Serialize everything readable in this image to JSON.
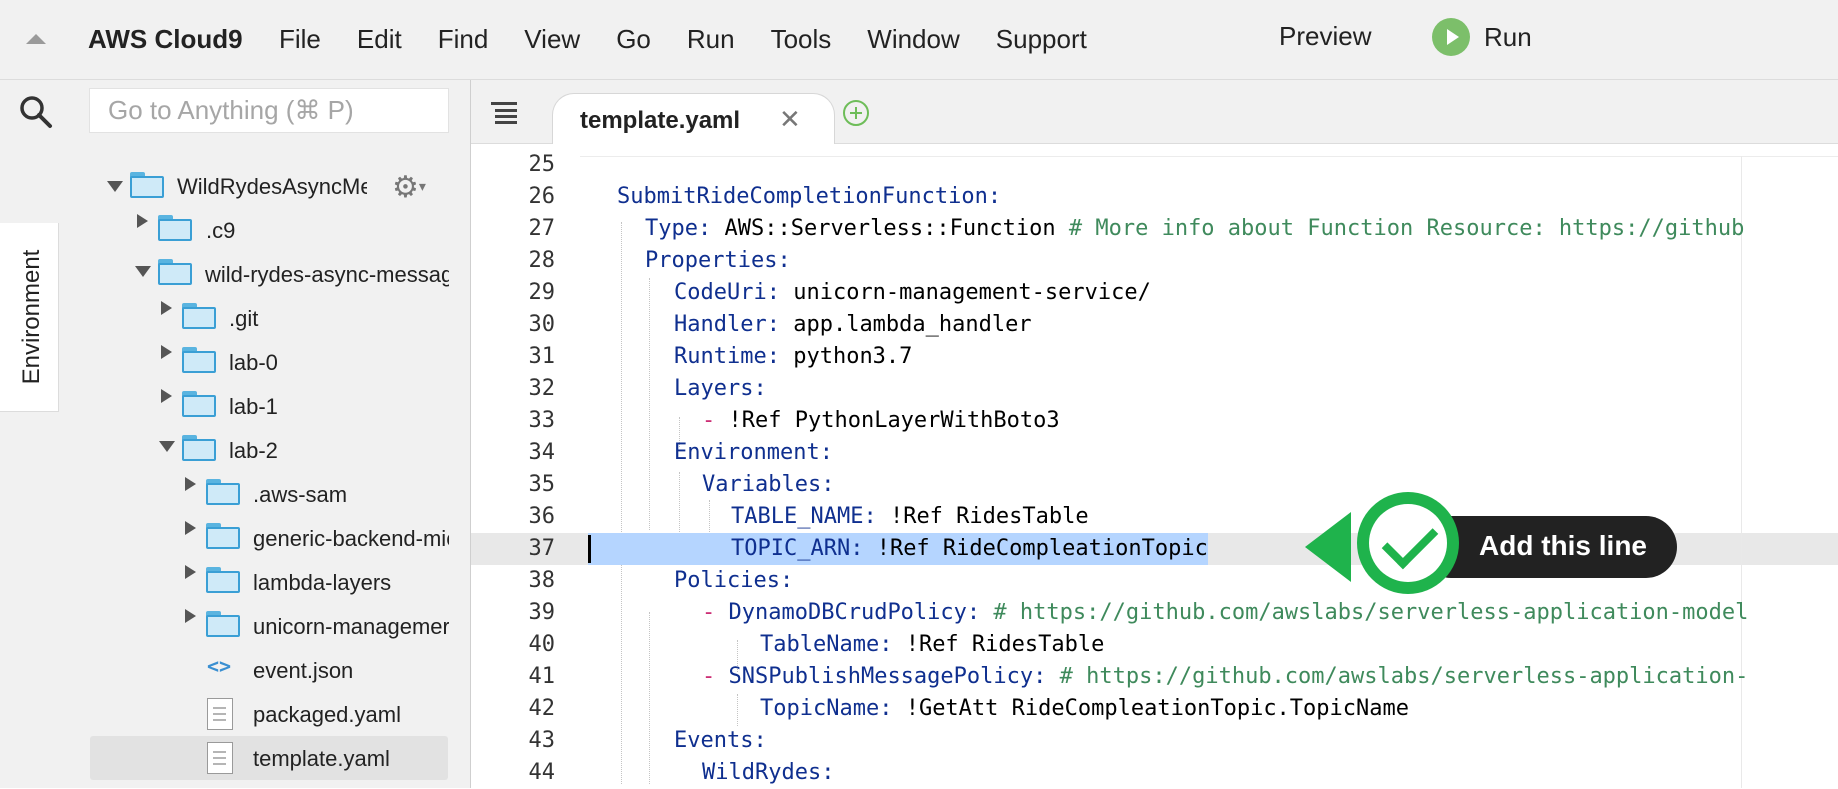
{
  "app": {
    "brand": "AWS Cloud9",
    "menu": [
      "File",
      "Edit",
      "Find",
      "View",
      "Go",
      "Run",
      "Tools",
      "Window",
      "Support"
    ],
    "preview_label": "Preview",
    "run_label": "Run"
  },
  "sidebar": {
    "environment_tab": "Environment",
    "search_placeholder": "Go to Anything (⌘ P)"
  },
  "tree": [
    {
      "label": "WildRydesAsyncMes",
      "type": "folder",
      "expanded": true
    },
    {
      "label": ".c9",
      "type": "folder",
      "expanded": false
    },
    {
      "label": "wild-rydes-async-messag",
      "type": "folder",
      "expanded": true
    },
    {
      "label": ".git",
      "type": "folder",
      "expanded": false
    },
    {
      "label": "lab-0",
      "type": "folder",
      "expanded": false
    },
    {
      "label": "lab-1",
      "type": "folder",
      "expanded": false
    },
    {
      "label": "lab-2",
      "type": "folder",
      "expanded": true
    },
    {
      "label": ".aws-sam",
      "type": "folder",
      "expanded": false
    },
    {
      "label": "generic-backend-mic",
      "type": "folder",
      "expanded": false
    },
    {
      "label": "lambda-layers",
      "type": "folder",
      "expanded": false
    },
    {
      "label": "unicorn-managemer",
      "type": "folder",
      "expanded": false
    },
    {
      "label": "event.json",
      "type": "json-file"
    },
    {
      "label": "packaged.yaml",
      "type": "file"
    },
    {
      "label": "template.yaml",
      "type": "file",
      "selected": true
    }
  ],
  "editor": {
    "tab_label": "template.yaml",
    "lines": [
      {
        "num": "25"
      },
      {
        "num": "26"
      },
      {
        "num": "27"
      },
      {
        "num": "28"
      },
      {
        "num": "29"
      },
      {
        "num": "30"
      },
      {
        "num": "31"
      },
      {
        "num": "32"
      },
      {
        "num": "33"
      },
      {
        "num": "34"
      },
      {
        "num": "35"
      },
      {
        "num": "36"
      },
      {
        "num": "37"
      },
      {
        "num": "38"
      },
      {
        "num": "39"
      },
      {
        "num": "40"
      },
      {
        "num": "41"
      },
      {
        "num": "42"
      },
      {
        "num": "43"
      },
      {
        "num": "44"
      }
    ],
    "code": {
      "l26_key": "SubmitRideCompletionFunction:",
      "l27_key": "Type:",
      "l27_val": " AWS::Serverless::Function ",
      "l27_comment": "# More info about Function Resource: https://github",
      "l28_key": "Properties:",
      "l29_key": "CodeUri:",
      "l29_val": " unicorn-management-service/",
      "l30_key": "Handler:",
      "l30_val": " app.lambda_handler",
      "l31_key": "Runtime:",
      "l31_val": " python3.7",
      "l32_key": "Layers:",
      "l33_dash": "- ",
      "l33_val": "!Ref PythonLayerWithBoto3",
      "l34_key": "Environment:",
      "l35_key": "Variables:",
      "l36_key": "TABLE_NAME:",
      "l36_val": " !Ref RidesTable",
      "l37_key": "TOPIC_ARN:",
      "l37_val": " !Ref RideCompleationTopic",
      "l38_key": "Policies:",
      "l39_dash": "- ",
      "l39_key": "DynamoDBCrudPolicy:",
      "l39_comment": " # https://github.com/awslabs/serverless-application-model",
      "l40_key": "TableName:",
      "l40_val": " !Ref RidesTable",
      "l41_dash": "- ",
      "l41_key": "SNSPublishMessagePolicy:",
      "l41_comment": " # https://github.com/awslabs/serverless-application-",
      "l42_key": "TopicName:",
      "l42_val": " !GetAtt RideCompleationTopic.TopicName",
      "l43_key": "Events:",
      "l44_key": "WildRydes:"
    },
    "callout_text": "Add this line"
  },
  "colors": {
    "yaml_key": "#0f2f8f",
    "comment": "#3f8a5c",
    "dash": "#cc2d74",
    "selection": "#b5d5ff",
    "callout_green": "#1fb34c"
  }
}
